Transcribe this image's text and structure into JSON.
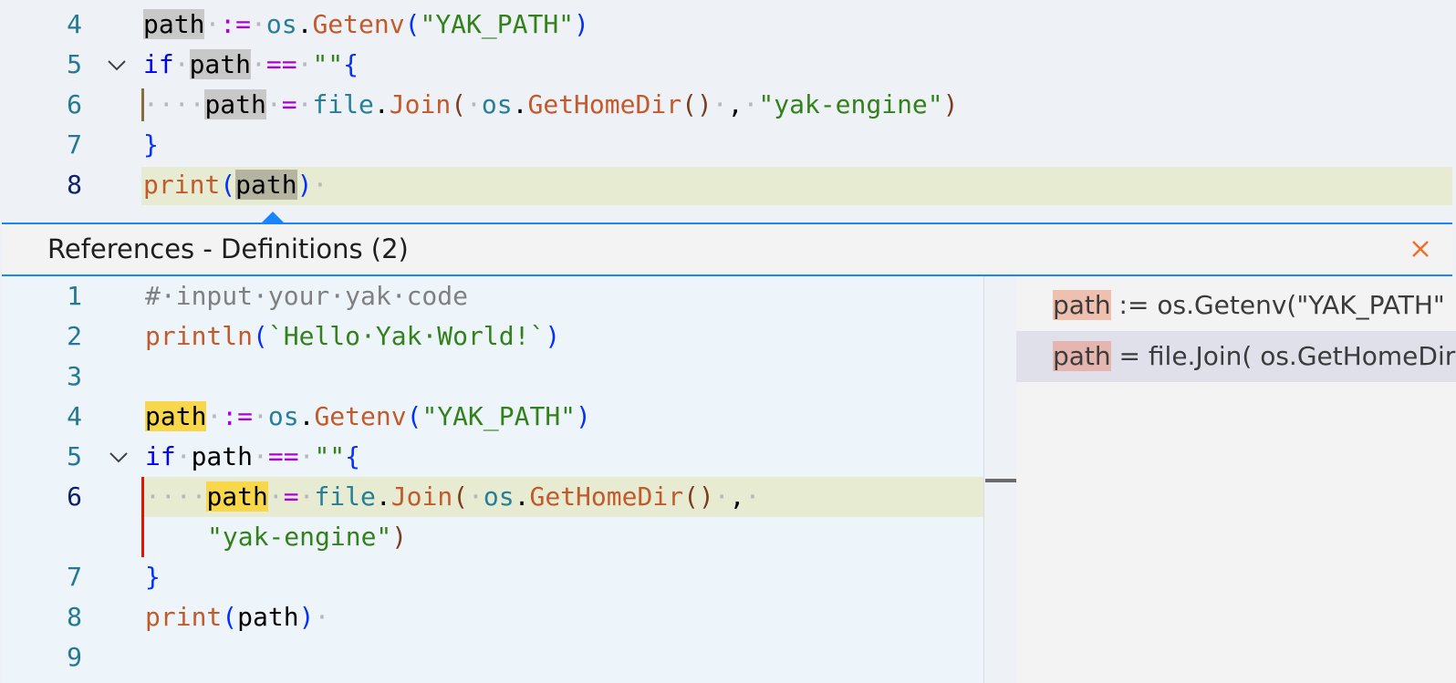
{
  "top_editor": {
    "lines": [
      {
        "num": "4"
      },
      {
        "num": "5"
      },
      {
        "num": "6"
      },
      {
        "num": "7"
      },
      {
        "num": "8"
      }
    ]
  },
  "peek": {
    "title": "References - Definitions (2)",
    "close_icon": "close-icon",
    "lines": [
      {
        "num": "1"
      },
      {
        "num": "2"
      },
      {
        "num": "3"
      },
      {
        "num": "4"
      },
      {
        "num": "5"
      },
      {
        "num": "6"
      },
      {
        "num": "7"
      },
      {
        "num": "8"
      },
      {
        "num": "9"
      }
    ],
    "references": [
      {
        "match": "path",
        "rest": " := os.Getenv(\"YAK_PATH\""
      },
      {
        "match": "path",
        "rest": " = file.Join( os.GetHomeDir"
      }
    ]
  },
  "tokens": {
    "path": "path",
    "assign_decl": ":=",
    "assign": "=",
    "eq": "==",
    "os": "os",
    "dot": ".",
    "getenv": "Getenv",
    "yak_path_str": "\"YAK_PATH\"",
    "lparen": "(",
    "rparen": ")",
    "if": "if",
    "empty_str": "\"\"",
    "lbrace": "{",
    "rbrace": "}",
    "file": "file",
    "join": "Join",
    "gethomedir": "GetHomeDir",
    "comma": ",",
    "yak_engine_str": "\"yak-engine\")",
    "yak_engine_str_only": "\"yak-engine\"",
    "print": "print",
    "println": "println",
    "hello": "`Hello·Yak·World!`",
    "comment": "#·input·your·yak·code",
    "dot_space": "·",
    "dots4": "····"
  },
  "colors": {
    "accent": "#1a85ff",
    "close": "#f26d2a",
    "keyword": "#0000ff",
    "function": "#c25a2c",
    "string": "#32811b",
    "operator": "#af00db",
    "package": "#267f99",
    "line_number": "#237893",
    "active_line_number": "#0b216f",
    "error_bar": "#e51400"
  }
}
